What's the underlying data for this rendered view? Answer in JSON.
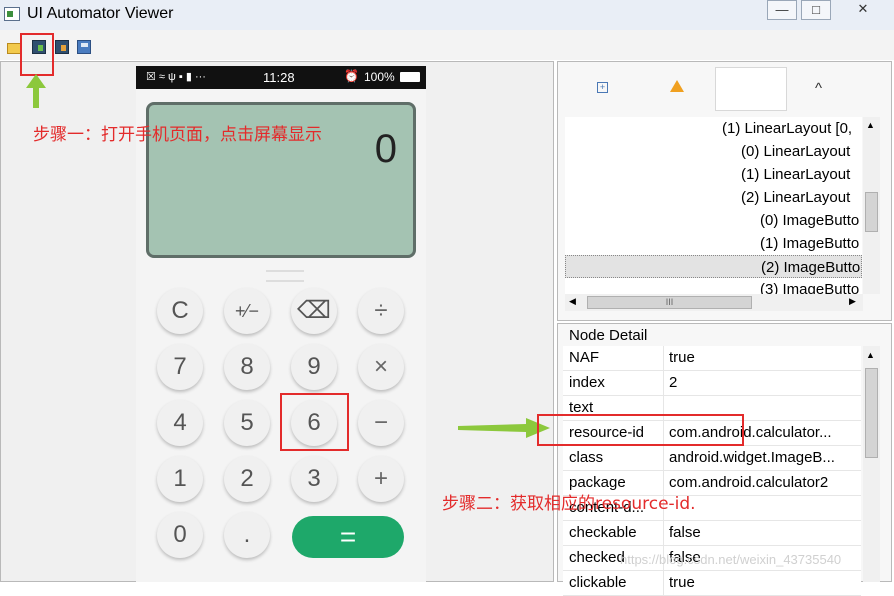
{
  "window": {
    "title": "UI Automator Viewer",
    "controls": {
      "minimize": "—",
      "maximize": "□",
      "close": "✕"
    }
  },
  "toolbar": {
    "icons": [
      "open-folder-icon",
      "device-screenshot-icon",
      "device-screenshot-compressed-icon",
      "save-icon"
    ]
  },
  "phone": {
    "status_bar": {
      "time": "11:28",
      "battery": "100%"
    },
    "display_value": "0",
    "keys": [
      {
        "label": "C",
        "name": "key-clear"
      },
      {
        "label": "+⁄−",
        "name": "key-plus-minus"
      },
      {
        "label": "⌫",
        "name": "key-backspace"
      },
      {
        "label": "÷",
        "name": "key-divide"
      },
      {
        "label": "7",
        "name": "key-7"
      },
      {
        "label": "8",
        "name": "key-8"
      },
      {
        "label": "9",
        "name": "key-9"
      },
      {
        "label": "×",
        "name": "key-multiply"
      },
      {
        "label": "4",
        "name": "key-4"
      },
      {
        "label": "5",
        "name": "key-5"
      },
      {
        "label": "6",
        "name": "key-6"
      },
      {
        "label": "−",
        "name": "key-minus"
      },
      {
        "label": "1",
        "name": "key-1"
      },
      {
        "label": "2",
        "name": "key-2"
      },
      {
        "label": "3",
        "name": "key-3"
      },
      {
        "label": "+",
        "name": "key-plus"
      },
      {
        "label": "0",
        "name": "key-0"
      },
      {
        "label": ".",
        "name": "key-dot"
      }
    ],
    "equals_label": "="
  },
  "tree": {
    "collapse_up": "^",
    "rows": [
      {
        "label": "(1) LinearLayout [0,",
        "depth": 0,
        "selected": false
      },
      {
        "label": "(0) LinearLayout",
        "depth": 1,
        "selected": false
      },
      {
        "label": "(1) LinearLayout",
        "depth": 1,
        "selected": false
      },
      {
        "label": "(2) LinearLayout",
        "depth": 1,
        "selected": false
      },
      {
        "label": "(0) ImageButto",
        "depth": 2,
        "selected": false
      },
      {
        "label": "(1) ImageButto",
        "depth": 2,
        "selected": false
      },
      {
        "label": "(2) ImageButto",
        "depth": 2,
        "selected": true
      },
      {
        "label": "(3) ImageButto",
        "depth": 2,
        "selected": false
      }
    ],
    "hscroll_grip": "III"
  },
  "node_detail": {
    "title": "Node Detail",
    "rows": [
      {
        "key": "NAF",
        "value": "true"
      },
      {
        "key": "index",
        "value": "2"
      },
      {
        "key": "text",
        "value": ""
      },
      {
        "key": "resource-id",
        "value": "com.android.calculator..."
      },
      {
        "key": "class",
        "value": "android.widget.ImageB..."
      },
      {
        "key": "package",
        "value": "com.android.calculator2"
      },
      {
        "key": "content-d...",
        "value": ""
      },
      {
        "key": "checkable",
        "value": "false"
      },
      {
        "key": "checked",
        "value": "false"
      },
      {
        "key": "clickable",
        "value": "true"
      }
    ]
  },
  "annotations": {
    "step1": "步骤一：打开手机页面，点击屏幕显示",
    "step2": "步骤二：获取相应的resource-id.",
    "arrow_color": "#8cc83c",
    "box_color": "#e32b2b"
  },
  "watermark": "https://blog.csdn.net/weixin_43735540"
}
